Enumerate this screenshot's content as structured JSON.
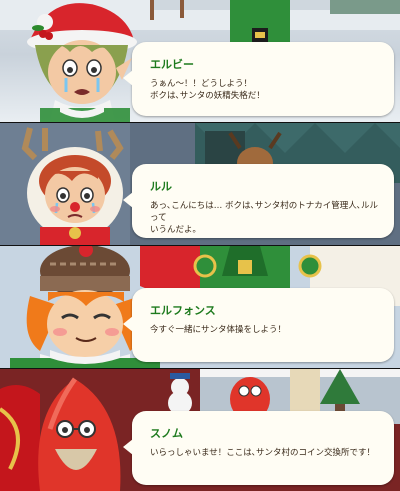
{
  "dialogues": [
    {
      "speaker": "エルビー",
      "lines": [
        "うぁん～！！どうしよう！",
        "ボクは､サンタの妖精失格だ！"
      ]
    },
    {
      "speaker": "ルル",
      "lines": [
        "あっ､こんにちは… ボクは､サンタ村のトナカイ管理人､ルルって",
        "いうんだよ｡"
      ]
    },
    {
      "speaker": "エルフォンス",
      "lines": [
        "今すぐ一緒にサンタ体操をしよう！",
        ""
      ]
    },
    {
      "speaker": "スノム",
      "lines": [
        "いらっしゃいませ！ここは､サンタ村のコイン交換所です！",
        ""
      ]
    }
  ],
  "colors": {
    "speaker_name": "#1d7a1d",
    "bubble_bg": "#fffdf4",
    "dialogue_text": "#3a2a1a"
  }
}
